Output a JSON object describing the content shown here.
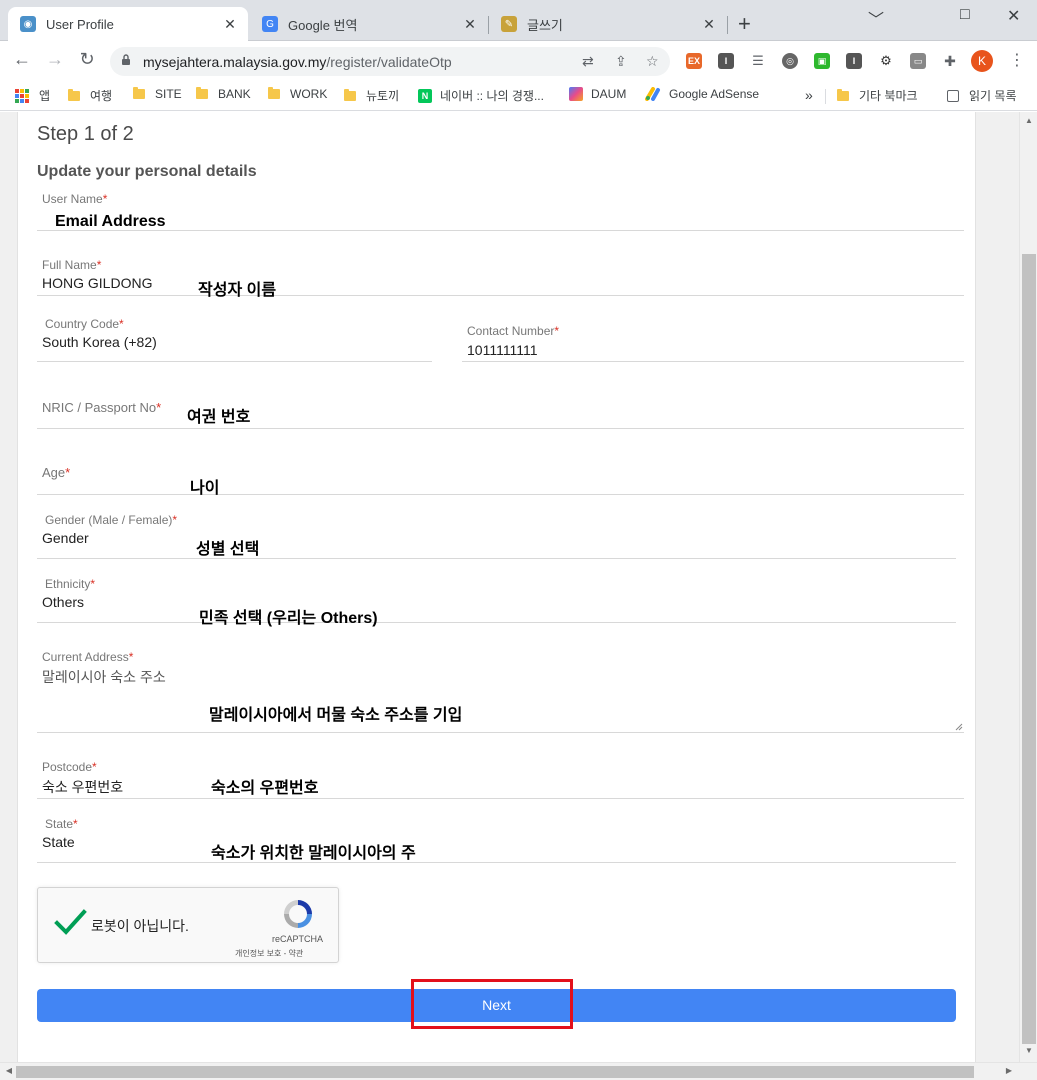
{
  "browser": {
    "tabs": [
      {
        "title": "User Profile",
        "close": "✕"
      },
      {
        "title": "Google 번역",
        "close": "✕"
      },
      {
        "title": "글쓰기",
        "close": "✕"
      }
    ],
    "new_tab": "+",
    "window": {
      "minimize": "﹀",
      "maximize": "□",
      "close": "✕"
    },
    "url_host": "mysejahtera.malaysia.gov.my",
    "url_path": "/register/validateOtp",
    "profile_initial": "K",
    "extensions": [
      "EX",
      "I",
      "I"
    ],
    "bookmarks": [
      {
        "label": "앱",
        "icon": "apps-grid-icon"
      },
      {
        "label": "여행",
        "icon": "folder-icon"
      },
      {
        "label": "SITE",
        "icon": "folder-icon"
      },
      {
        "label": "BANK",
        "icon": "folder-icon"
      },
      {
        "label": "WORK",
        "icon": "folder-icon"
      },
      {
        "label": "뉴토끼",
        "icon": "folder-icon"
      },
      {
        "label": "네이버 :: 나의 경쟁...",
        "icon": "naver-icon"
      },
      {
        "label": "DAUM",
        "icon": "daum-icon"
      },
      {
        "label": "Google AdSense",
        "icon": "adsense-icon"
      },
      {
        "label": "기타 북마크",
        "icon": "folder-icon"
      },
      {
        "label": "읽기 목록",
        "icon": "reading-list-icon"
      }
    ],
    "bookmarks_overflow": "»",
    "naver_glyph": "N"
  },
  "form": {
    "title": "Step 1 of 2",
    "subtitle": "Update your personal details",
    "required_mark": "*",
    "fields": {
      "username": {
        "label": "User Name",
        "value": ""
      },
      "fullname": {
        "label": "Full Name",
        "value": "HONG GILDONG"
      },
      "country": {
        "label": "Country Code",
        "value": "South Korea (+82)"
      },
      "contact": {
        "label": "Contact Number",
        "value": "1011111111"
      },
      "nric": {
        "label": "NRIC / Passport No",
        "value": ""
      },
      "age": {
        "label": "Age",
        "value": ""
      },
      "gender": {
        "label": "Gender (Male / Female)",
        "value": "Gender"
      },
      "ethnicity": {
        "label": "Ethnicity",
        "value": "Others"
      },
      "address": {
        "label": "Current Address",
        "value": "말레이시아 숙소 주소"
      },
      "postcode": {
        "label": "Postcode",
        "value": "숙소 우편번호"
      },
      "state": {
        "label": "State",
        "value": "State"
      }
    },
    "recaptcha": {
      "text": "로봇이 아닙니다.",
      "brand": "reCAPTCHA",
      "links": "개인정보 보호 - 약관"
    },
    "next_label": "Next"
  },
  "annotations": {
    "username": "Email Address",
    "fullname": "작성자 이름",
    "nric": "여권 번호",
    "age": "나이",
    "gender": "성별 선택",
    "ethnicity": "민족 선택 (우리는 Others)",
    "address": "말레이시아에서 머물 숙소 주소를 기입",
    "postcode": "숙소의 우편번호",
    "state": "숙소가 위치한 말레이시아의 주"
  },
  "colors": {
    "accent": "#4285f4",
    "highlight_box": "#e3101b",
    "required": "#d93025",
    "check": "#009e55"
  }
}
